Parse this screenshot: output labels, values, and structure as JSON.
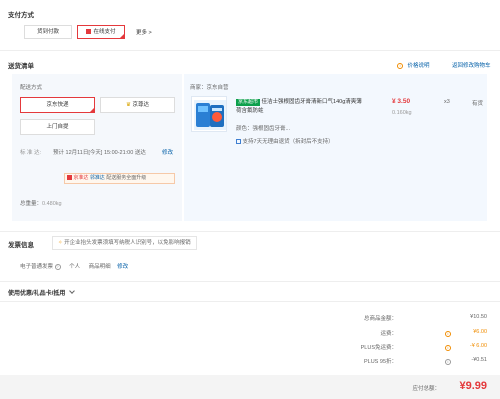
{
  "payment": {
    "title": "支付方式",
    "option_cod": "货到付款",
    "option_online": "在线支付",
    "more": "更多 >"
  },
  "shipping": {
    "title": "送货清单",
    "price_note": "价格说明",
    "back_cart": "返回修改购物车",
    "method_label": "配送方式",
    "method_jd": "京东快递",
    "method_jzd": "京尊达",
    "method_pickup": "上门自提",
    "time_label": "标 准 达:",
    "time_value": "预计 12月11日[今天] 15:00-21:00 送达",
    "time_edit": "修改",
    "badge_brand": "京准达",
    "badge_text": "配送服务全面升级",
    "badge_link": "邻准达",
    "weight_label": "总重量：",
    "weight_value": "0.480kg"
  },
  "product": {
    "seller_label": "商家：",
    "seller": "京东自营",
    "tag": "京东超市",
    "name": "佳洁士强根固齿牙膏清新口气140g清爽薄荷含氟防蛀",
    "spec_label": "颜色：",
    "spec": "强根固齿牙膏...",
    "service": "支持7天无理由退货（拆封后不支持）",
    "price": "¥ 3.50",
    "weight": "0.160kg",
    "qty": "x3",
    "stock": "有货"
  },
  "invoice": {
    "title": "发票信息",
    "tip": "开企业抬头发票须填写纳税人识别号，以免影响报销",
    "type": "电子普通发票",
    "person": "个人",
    "detail": "商品明细",
    "edit": "修改"
  },
  "discount": {
    "title": "使用优惠/礼品卡/抵用",
    "chevron": "chevron-down-icon"
  },
  "summary": {
    "rows": [
      {
        "label": "总商品金额：",
        "value": "¥10.50"
      },
      {
        "label": "运费：",
        "value": "¥6.00"
      },
      {
        "label": "PLUS免运费：",
        "value": "-¥ 6.00"
      },
      {
        "label": "PLUS 95折：",
        "value": "-¥0.51"
      }
    ],
    "total_label": "应付总额：",
    "total_value": "¥9.99"
  },
  "colors": {
    "accent": "#e4393c",
    "link": "#005ea7",
    "panel": "#f5f8fc",
    "product_panel": "#f3f8fe"
  }
}
